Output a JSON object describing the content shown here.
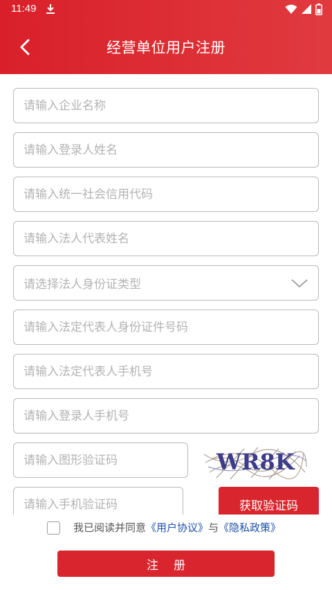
{
  "status_bar": {
    "time": "11:49",
    "icons": [
      "download-icon",
      "wifi-icon",
      "signal-icon",
      "battery-icon"
    ]
  },
  "header": {
    "title": "经营单位用户注册",
    "back_icon": "chevron-left-icon",
    "background": "#d9202a"
  },
  "form": {
    "company_name": {
      "placeholder": "请输入企业名称"
    },
    "login_name": {
      "placeholder": "请输入登录人姓名"
    },
    "credit_code": {
      "placeholder": "请输入统一社会信用代码"
    },
    "legal_rep_name": {
      "placeholder": "请输入法人代表姓名"
    },
    "id_type": {
      "placeholder": "请选择法人身份证类型",
      "icon": "chevron-down-icon"
    },
    "legal_rep_id": {
      "placeholder": "请输入法定代表人身份证件号码"
    },
    "legal_rep_phone": {
      "placeholder": "请输入法定代表人手机号"
    },
    "login_phone": {
      "placeholder": "请输入登录人手机号"
    },
    "image_captcha": {
      "placeholder": "请输入图形验证码",
      "captcha_text": "WR8K"
    },
    "sms_code": {
      "placeholder": "请输入手机验证码",
      "button_label": "获取验证码"
    }
  },
  "agreement": {
    "prefix": "我已阅读并同意",
    "user_agreement": "《用户协议》",
    "conjunction": "与",
    "privacy_policy": "《隐私政策》",
    "checked": false
  },
  "submit": {
    "label": "注册"
  },
  "colors": {
    "accent": "#d9252d",
    "link": "#1f4fa8",
    "border": "#b8b8b8",
    "placeholder": "#b3b3b3"
  }
}
